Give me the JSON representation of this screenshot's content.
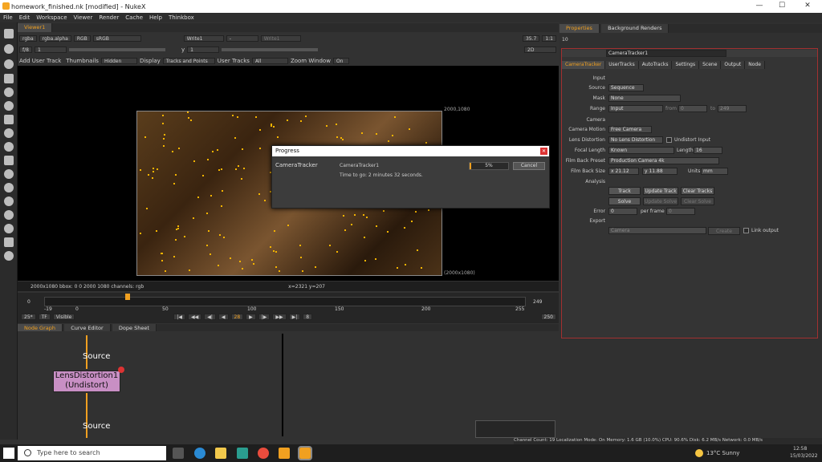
{
  "window": {
    "title": "homework_finished.nk [modified] - NukeX"
  },
  "menu": [
    "File",
    "Edit",
    "Workspace",
    "Viewer",
    "Render",
    "Cache",
    "Help",
    "Thinkbox"
  ],
  "viewer": {
    "tab": "Viewer1",
    "channels": "rgba",
    "alpha": "rgba.alpha",
    "mode": "RGB",
    "lut": "sRGB",
    "input_a": "Write1",
    "input_b": "Write1",
    "fstop": "f/8",
    "frame_field": "1",
    "y_field": "1",
    "zoom": "35.7",
    "ratio": "1:1",
    "view2d": "2D",
    "toolbar": {
      "add_user_track": "Add User Track",
      "thumbnails_label": "Thumbnails",
      "thumbnails_val": "Hidden",
      "display_label": "Display",
      "display_val": "Tracks and Points",
      "usertracks_label": "User Tracks",
      "usertracks_val": "All",
      "zoomwindow_label": "Zoom Window",
      "zoomwindow_val": "On"
    },
    "format_tl": "2000,1080",
    "format_br": "(2000x1080)",
    "status_left": "2000x1080  bbox: 0 0 2000 1080 channels: rgb",
    "status_coords": "x=2321 y=207"
  },
  "progress": {
    "title": "Progress",
    "node": "CameraTracker",
    "task": "CameraTracker1",
    "percent": "5%",
    "percent_value": 5,
    "time_to_go": "Time to go: 2 minutes 32 seconds.",
    "cancel": "Cancel"
  },
  "timeline": {
    "start": "0",
    "end": "249",
    "ticks": [
      "-19",
      "0",
      "50",
      "100",
      "150",
      "200",
      "255"
    ],
    "current": "28",
    "fps": "25*",
    "tf": "TF",
    "visible": "Visible",
    "step": "8",
    "end_frame": "250",
    "marker": "28"
  },
  "tabs_bottom": [
    "Node Graph",
    "Curve Editor",
    "Dope Sheet"
  ],
  "nodegraph": {
    "source_top": "Source",
    "node_line1": "LensDistortion1",
    "node_line2": "(Undistort)",
    "source_bottom": "Source"
  },
  "properties": {
    "tabs": [
      "Properties",
      "Background Renders"
    ],
    "count": "10",
    "node_name": "CameraTracker1",
    "subtabs": [
      "CameraTracker",
      "UserTracks",
      "AutoTracks",
      "Settings",
      "Scene",
      "Output",
      "Node"
    ],
    "input_section": "Input",
    "source_label": "Source",
    "source_val": "Sequence",
    "mask_label": "Mask",
    "mask_val": "None",
    "range_label": "Range",
    "range_val": "Input",
    "from_label": "from",
    "from_val": "0",
    "to_label": "to",
    "to_val": "249",
    "camera_section": "Camera",
    "motion_label": "Camera Motion",
    "motion_val": "Free Camera",
    "lens_label": "Lens Distortion",
    "lens_val": "No Lens Distortion",
    "undistort_label": "Undistort Input",
    "focal_label": "Focal Length",
    "focal_val": "Known",
    "length_label": "Length",
    "length_val": "16",
    "filmback_label": "Film Back Preset",
    "filmback_val": "Production Camera 4k",
    "fbsize_label": "Film Back Size",
    "fbx": "x 21.12",
    "fby": "y 11.88",
    "units_label": "Units",
    "units_val": "mm",
    "analysis_section": "Analysis",
    "track": "Track",
    "update_track": "Update Track",
    "clear_tracks": "Clear Tracks",
    "solve": "Solve",
    "update_solve": "Update Solve",
    "clear_solve": "Clear Solve",
    "error_label": "Error",
    "error_val": "0",
    "perframe_label": "per frame",
    "perframe_val": "0",
    "export_section": "Export",
    "export_val": "Camera",
    "create": "Create",
    "link_output": "Link output"
  },
  "statusbar": "Channel Count: 19  Localization Mode: On  Memory: 1.6 GB (10.0%)  CPU: 90.6%  Disk: 6.2 MB/s  Network: 0.0 MB/s",
  "taskbar": {
    "search": "Type here to search",
    "weather": "13°C  Sunny",
    "time": "12:58",
    "date": "15/03/2022"
  }
}
